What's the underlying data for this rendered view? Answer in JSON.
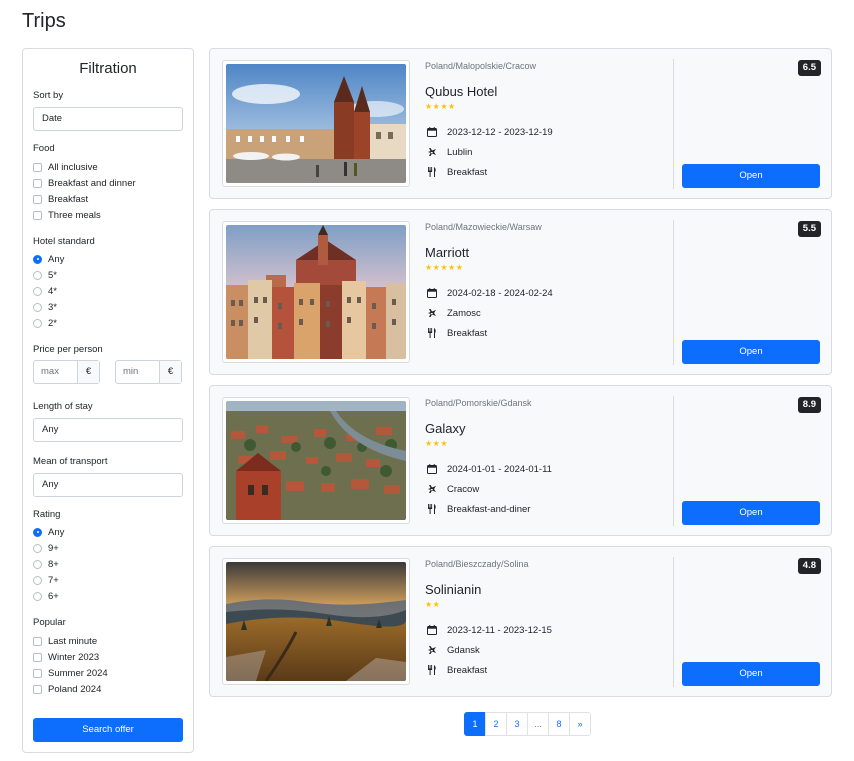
{
  "page": {
    "title": "Trips"
  },
  "filters": {
    "title": "Filtration",
    "sort": {
      "label": "Sort by",
      "value": "Date"
    },
    "food": {
      "label": "Food",
      "options": [
        "All inclusive",
        "Breakfast and dinner",
        "Breakfast",
        "Three meals"
      ]
    },
    "hotel_standard": {
      "label": "Hotel standard",
      "options": [
        "Any",
        "5*",
        "4*",
        "3*",
        "2*"
      ],
      "selected": "Any"
    },
    "price": {
      "label": "Price per person",
      "max_placeholder": "max",
      "min_placeholder": "min",
      "currency": "€"
    },
    "length": {
      "label": "Length of stay",
      "value": "Any"
    },
    "transport": {
      "label": "Mean of transport",
      "value": "Any"
    },
    "rating": {
      "label": "Rating",
      "options": [
        "Any",
        "9+",
        "8+",
        "7+",
        "6+"
      ],
      "selected": "Any"
    },
    "popular": {
      "label": "Popular",
      "options": [
        "Last minute",
        "Winter 2023",
        "Summer 2024",
        "Poland 2024"
      ]
    },
    "search_label": "Search offer"
  },
  "trips": [
    {
      "location": "Poland/Malopolskie/Cracow",
      "name": "Qubus Hotel",
      "stars": 4,
      "stars_text": "★★★★",
      "dates": "2023-12-12 - 2023-12-19",
      "departure": "Lublin",
      "food": "Breakfast",
      "rating": "6.5",
      "open_label": "Open"
    },
    {
      "location": "Poland/Mazowieckie/Warsaw",
      "name": "Marriott",
      "stars": 5,
      "stars_text": "★★★★★",
      "dates": "2024-02-18 - 2024-02-24",
      "departure": "Zamosc",
      "food": "Breakfast",
      "rating": "5.5",
      "open_label": "Open"
    },
    {
      "location": "Poland/Pomorskie/Gdansk",
      "name": "Galaxy",
      "stars": 3,
      "stars_text": "★★★",
      "dates": "2024-01-01 - 2024-01-11",
      "departure": "Cracow",
      "food": "Breakfast-and-diner",
      "rating": "8.9",
      "open_label": "Open"
    },
    {
      "location": "Poland/Bieszczady/Solina",
      "name": "Solinianin",
      "stars": 2,
      "stars_text": "★★",
      "dates": "2023-12-11 - 2023-12-15",
      "departure": "Gdansk",
      "food": "Breakfast",
      "rating": "4.8",
      "open_label": "Open"
    }
  ],
  "pagination": {
    "pages": [
      "1",
      "2",
      "3",
      "...",
      "8",
      "»"
    ],
    "active": "1"
  },
  "icons": {
    "dates": "calendar-icon",
    "departure": "plane-icon",
    "food": "utensils-icon"
  },
  "colors": {
    "primary": "#0d6efd",
    "rating_badge": "#212529",
    "stars": "#ffc107"
  }
}
